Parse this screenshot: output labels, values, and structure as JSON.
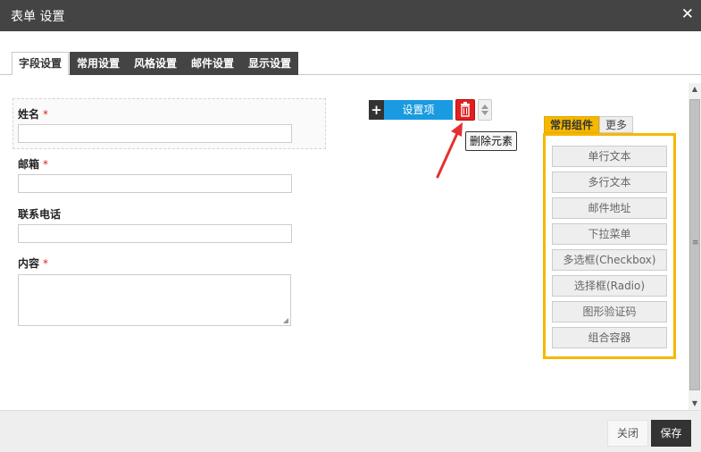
{
  "dialog": {
    "title": "表单 设置",
    "close_glyph": "✕"
  },
  "tabs": [
    {
      "label": "字段设置",
      "active": true
    },
    {
      "label": "常用设置",
      "active": false
    },
    {
      "label": "风格设置",
      "active": false
    },
    {
      "label": "邮件设置",
      "active": false
    },
    {
      "label": "显示设置",
      "active": false
    }
  ],
  "form": {
    "required_mark": "*",
    "fields": [
      {
        "label": "姓名",
        "required": true,
        "type": "text",
        "value": ""
      },
      {
        "label": "邮箱",
        "required": true,
        "type": "text",
        "value": ""
      },
      {
        "label": "联系电话",
        "required": false,
        "type": "text",
        "value": ""
      },
      {
        "label": "内容",
        "required": true,
        "type": "textarea",
        "value": ""
      }
    ]
  },
  "toolbar": {
    "add_icon": "plus-icon",
    "settings_label": "设置项",
    "delete_icon": "trash-icon",
    "move_icon": "up-down-arrows-icon",
    "tooltip": "删除元素",
    "accent_color": "#1a9ae0",
    "delete_color": "#e02020"
  },
  "components": {
    "tabs": [
      {
        "label": "常用组件",
        "active": true
      },
      {
        "label": "更多",
        "active": false
      }
    ],
    "items": [
      "单行文本",
      "多行文本",
      "邮件地址",
      "下拉菜单",
      "多选框(Checkbox)",
      "选择框(Radio)",
      "图形验证码",
      "组合容器"
    ],
    "accent_color": "#f5b800"
  },
  "footer": {
    "close_label": "关闭",
    "save_label": "保存"
  }
}
